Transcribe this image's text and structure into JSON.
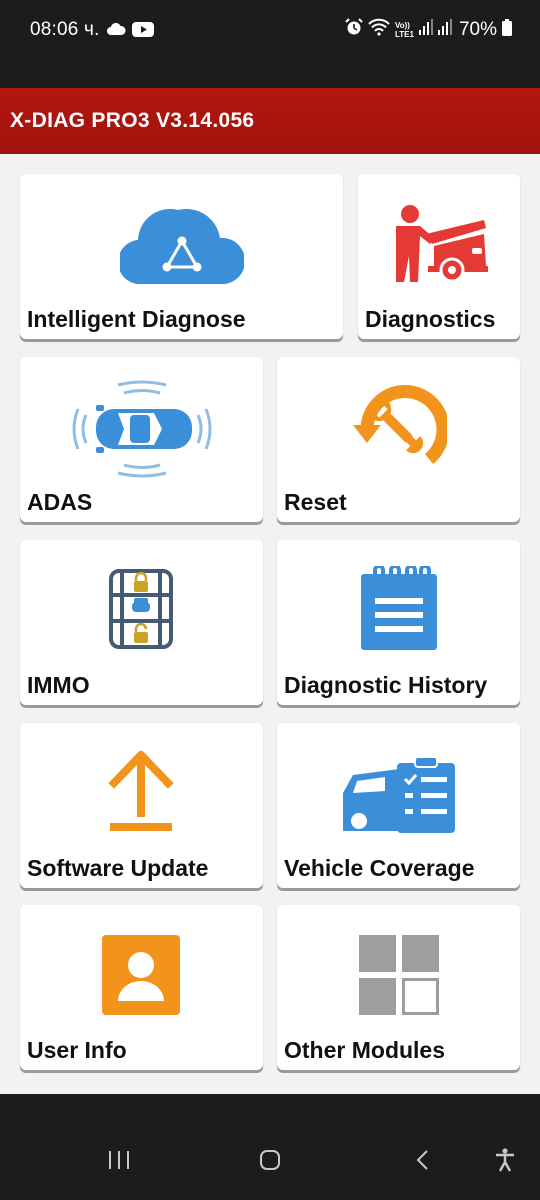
{
  "status_bar": {
    "time": "08:06 ч.",
    "left_icons": [
      "cloud-icon",
      "youtube-icon"
    ],
    "right_icons": [
      "alarm-icon",
      "wifi-icon",
      "volte-icon",
      "signal-icon",
      "signal-icon",
      "battery-icon"
    ],
    "volte_text": "Vo))\nLTE1",
    "battery": "70%"
  },
  "header": {
    "title": "X-DIAG PRO3 V3.14.056",
    "color": "#a8140e"
  },
  "tiles": [
    {
      "label": "Intelligent Diagnose",
      "icon": "cloud-diagnose-icon"
    },
    {
      "label": "Diagnostics",
      "icon": "mechanic-car-icon"
    },
    {
      "label": "ADAS",
      "icon": "adas-car-icon"
    },
    {
      "label": "Reset",
      "icon": "reset-wrench-icon"
    },
    {
      "label": "IMMO",
      "icon": "immo-lock-icon"
    },
    {
      "label": "Diagnostic History",
      "icon": "notepad-icon"
    },
    {
      "label": "Software Update",
      "icon": "upload-arrow-icon"
    },
    {
      "label": "Vehicle Coverage",
      "icon": "vehicle-checklist-icon"
    },
    {
      "label": "User Info",
      "icon": "user-card-icon"
    },
    {
      "label": "Other Modules",
      "icon": "modules-grid-icon"
    }
  ],
  "colors": {
    "blue": "#3b8fd9",
    "red": "#e53935",
    "orange": "#f2941b",
    "gray": "#9e9e9e"
  },
  "nav_bar": {
    "buttons": [
      "recents-icon",
      "home-icon",
      "back-icon",
      "accessibility-icon"
    ]
  }
}
